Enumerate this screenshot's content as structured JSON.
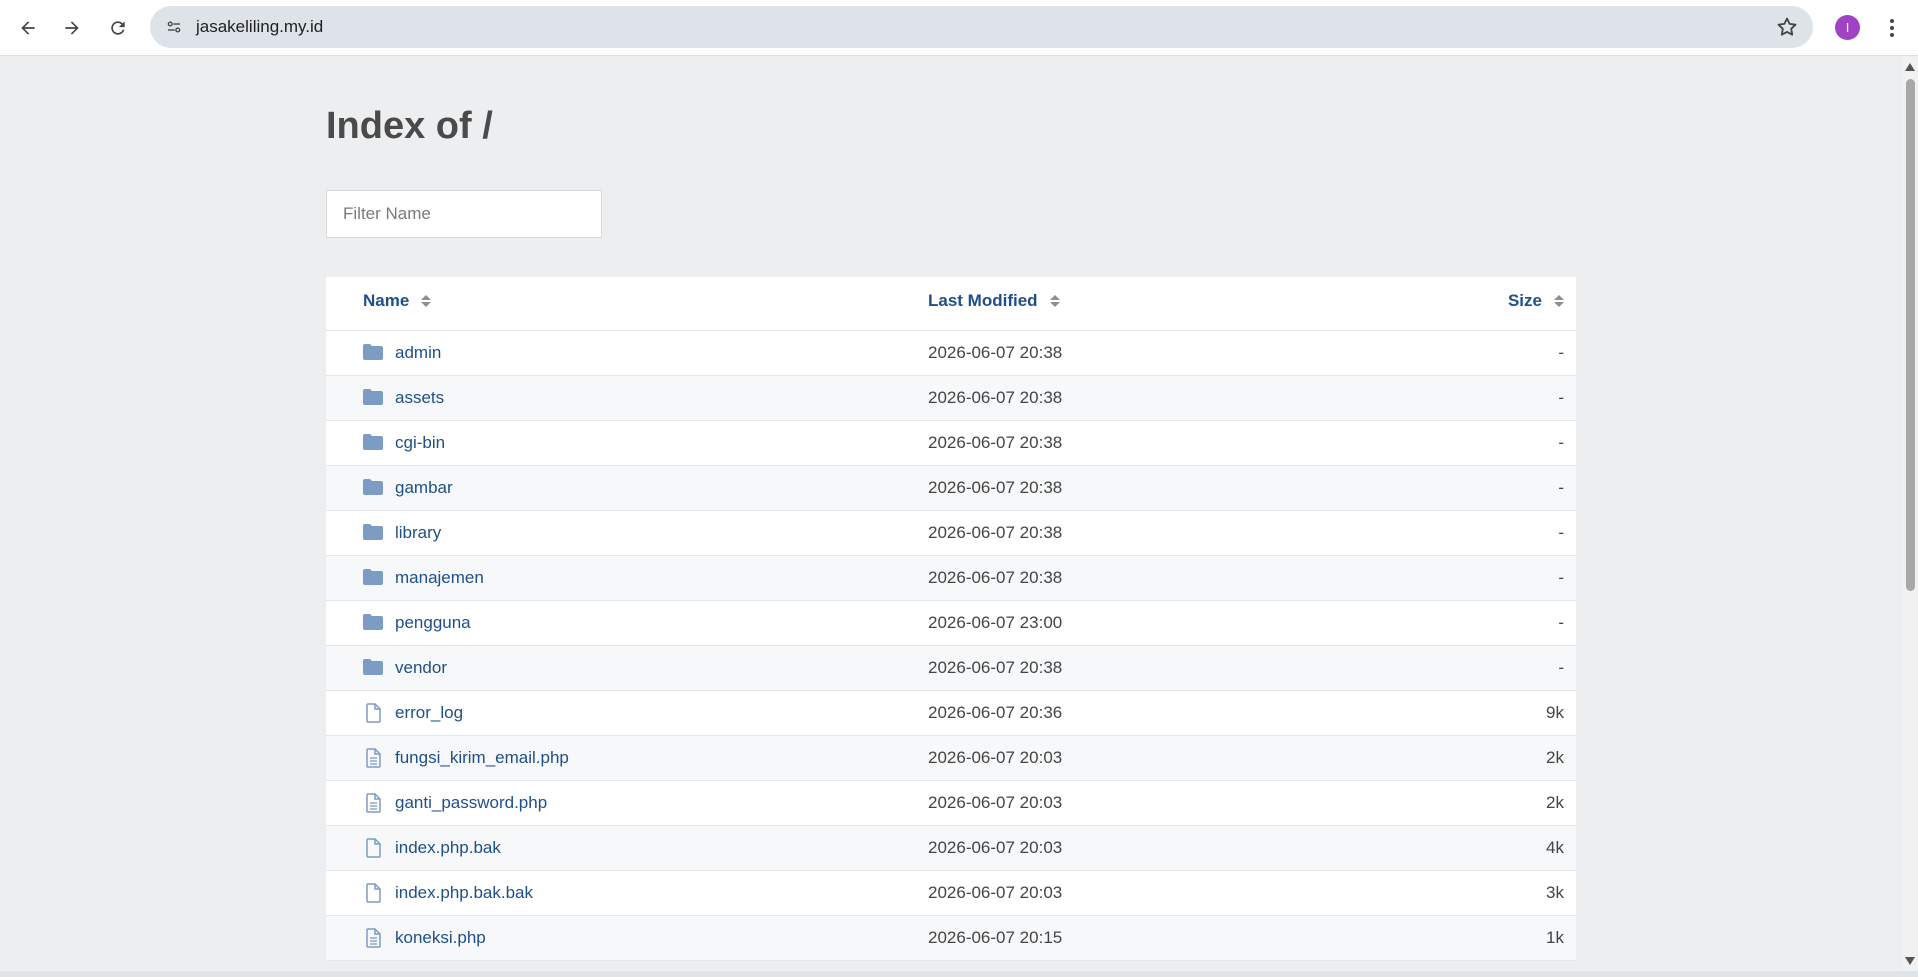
{
  "browser": {
    "url": "jasakeliling.my.id",
    "avatar_initial": "I",
    "avatar_color": "#a142c4"
  },
  "page": {
    "title": "Index of /",
    "filter_placeholder": "Filter Name",
    "columns": {
      "name": "Name",
      "modified": "Last Modified",
      "size": "Size"
    },
    "entries": [
      {
        "type": "folder",
        "name": "admin",
        "modified": "2026-06-07 20:38",
        "size": "-"
      },
      {
        "type": "folder",
        "name": "assets",
        "modified": "2026-06-07 20:38",
        "size": "-"
      },
      {
        "type": "folder",
        "name": "cgi-bin",
        "modified": "2026-06-07 20:38",
        "size": "-"
      },
      {
        "type": "folder",
        "name": "gambar",
        "modified": "2026-06-07 20:38",
        "size": "-"
      },
      {
        "type": "folder",
        "name": "library",
        "modified": "2026-06-07 20:38",
        "size": "-"
      },
      {
        "type": "folder",
        "name": "manajemen",
        "modified": "2026-06-07 20:38",
        "size": "-"
      },
      {
        "type": "folder",
        "name": "pengguna",
        "modified": "2026-06-07 23:00",
        "size": "-"
      },
      {
        "type": "folder",
        "name": "vendor",
        "modified": "2026-06-07 20:38",
        "size": "-"
      },
      {
        "type": "file",
        "name": "error_log",
        "modified": "2026-06-07 20:36",
        "size": "9k"
      },
      {
        "type": "text-file",
        "name": "fungsi_kirim_email.php",
        "modified": "2026-06-07 20:03",
        "size": "2k"
      },
      {
        "type": "text-file",
        "name": "ganti_password.php",
        "modified": "2026-06-07 20:03",
        "size": "2k"
      },
      {
        "type": "file",
        "name": "index.php.bak",
        "modified": "2026-06-07 20:03",
        "size": "4k"
      },
      {
        "type": "file",
        "name": "index.php.bak.bak",
        "modified": "2026-06-07 20:03",
        "size": "3k"
      },
      {
        "type": "text-file",
        "name": "koneksi.php",
        "modified": "2026-06-07 20:15",
        "size": "1k"
      }
    ]
  },
  "colors": {
    "link": "#1f4f8a",
    "folder_icon": "#7d9cc4",
    "page_bg": "#eceef0"
  }
}
